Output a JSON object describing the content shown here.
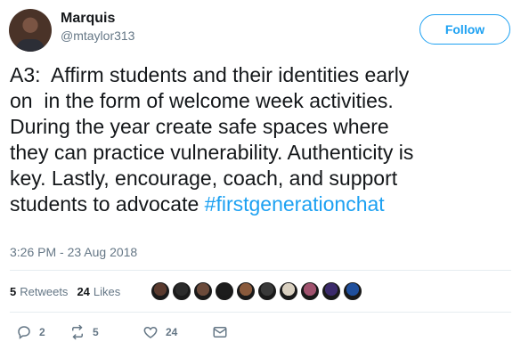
{
  "author": {
    "name": "Marquis",
    "handle": "@mtaylor313",
    "avatar_icon": "profile-photo"
  },
  "follow_button": {
    "label": "Follow",
    "color": "#1da1f2"
  },
  "tweet": {
    "text": "A3:  Affirm students and their identities early\non  in the form of welcome week activities.\nDuring the year create safe spaces where\nthey can practice vulnerability. Authenticity is\nkey. Lastly, encourage, coach, and support\nstudents to advocate ",
    "hashtag": "#firstgenerationchat",
    "timestamp": "3:26 PM - 23 Aug 2018"
  },
  "stats": {
    "retweets_count": "5",
    "retweets_label": "Retweets",
    "likes_count": "24",
    "likes_label": "Likes"
  },
  "liked_by_avatars": [
    {
      "icon": "person-avatar",
      "color": "#5a3a2e"
    },
    {
      "icon": "person-avatar",
      "color": "#2b2b2b"
    },
    {
      "icon": "person-avatar",
      "color": "#6b4a3a"
    },
    {
      "icon": "person-avatar",
      "color": "#1c1c1c"
    },
    {
      "icon": "person-avatar",
      "color": "#8a5a3c"
    },
    {
      "icon": "person-avatar",
      "color": "#3a3a3a"
    },
    {
      "icon": "logo-avatar",
      "color": "#d9d0c0"
    },
    {
      "icon": "person-avatar",
      "color": "#a0526e"
    },
    {
      "icon": "logo-avatar",
      "color": "#3b2a6b"
    },
    {
      "icon": "person-avatar",
      "color": "#1f4f9c"
    }
  ],
  "actions": {
    "reply_count": "2",
    "retweet_count": "5",
    "like_count": "24"
  },
  "colors": {
    "accent": "#1da1f2",
    "secondary_text": "#657786",
    "divider": "#e6ecf0"
  }
}
